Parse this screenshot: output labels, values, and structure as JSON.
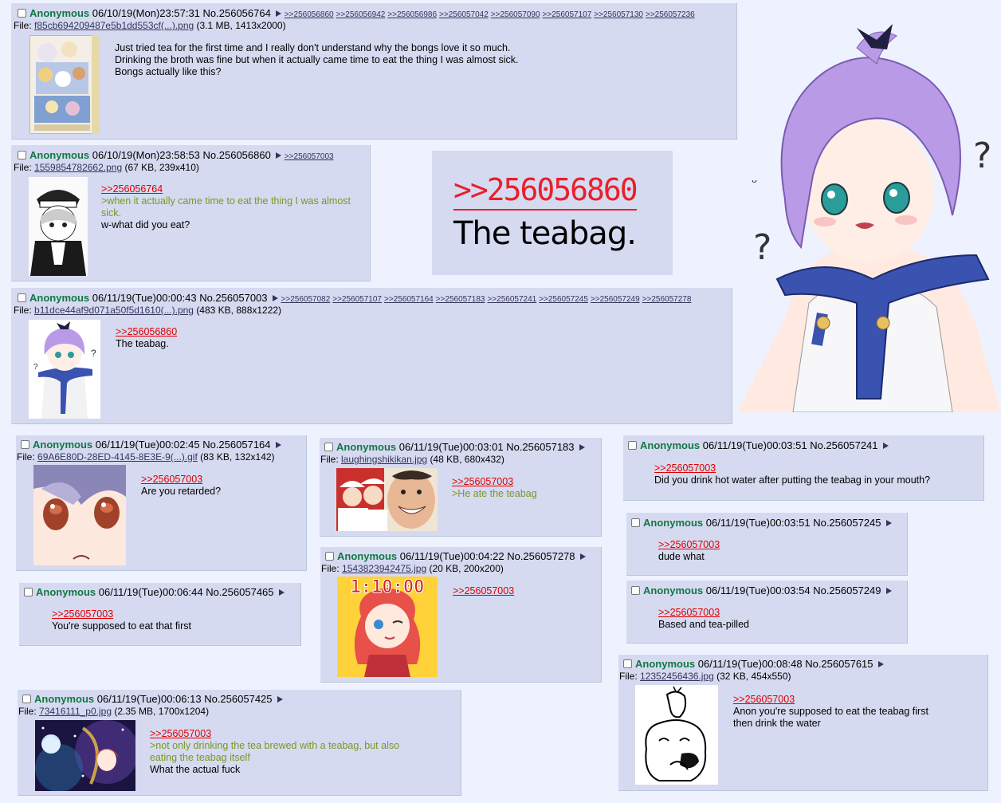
{
  "posts": {
    "p1": {
      "name": "Anonymous",
      "date": "06/10/19(Mon)23:57:31",
      "no": "No.256056764",
      "replies": [
        ">>256056860",
        ">>256056942",
        ">>256056986",
        ">>256057042",
        ">>256057090",
        ">>256057107",
        ">>256057130",
        ">>256057236"
      ],
      "file_label": "File:",
      "file_link": "f85cb694209487e5b1dd553cf(...).png",
      "file_info": "(3.1 MB, 1413x2000)",
      "lines": [
        "Just tried tea for the first time and I really don't understand why the bongs love it so much.",
        "Drinking the broth was fine but when it actually came time to eat the thing I was almost sick.",
        "Bongs actually like this?"
      ]
    },
    "p2": {
      "name": "Anonymous",
      "date": "06/10/19(Mon)23:58:53",
      "no": "No.256056860",
      "replies": [
        ">>256057003"
      ],
      "file_label": "File:",
      "file_link": "1559854782662.png",
      "file_info": "(67 KB, 239x410)",
      "quote": ">>256056764",
      "green": ">when it actually came time to eat the thing I was almost sick.",
      "text": "w-what did you eat?"
    },
    "p3": {
      "name": "Anonymous",
      "date": "06/11/19(Tue)00:00:43",
      "no": "No.256057003",
      "replies": [
        ">>256057082",
        ">>256057107",
        ">>256057164",
        ">>256057183",
        ">>256057241",
        ">>256057245",
        ">>256057249",
        ">>256057278"
      ],
      "file_label": "File:",
      "file_link": "b11dce44af9d071a50f5d1610(...).png",
      "file_info": "(483 KB, 888x1222)",
      "quote": ">>256056860",
      "text": "The teabag."
    },
    "p4": {
      "name": "Anonymous",
      "date": "06/11/19(Tue)00:02:45",
      "no": "No.256057164",
      "file_label": "File:",
      "file_link": "69A6E80D-28ED-4145-8E3E-9(...).gif",
      "file_info": "(83 KB, 132x142)",
      "quote": ">>256057003",
      "text": "Are you retarded?"
    },
    "p5": {
      "name": "Anonymous",
      "date": "06/11/19(Tue)00:03:01",
      "no": "No.256057183",
      "file_label": "File:",
      "file_link": "laughingshikikan.jpg",
      "file_info": "(48 KB, 680x432)",
      "quote": ">>256057003",
      "green": ">He ate the teabag"
    },
    "p6": {
      "name": "Anonymous",
      "date": "06/11/19(Tue)00:03:51",
      "no": "No.256057241",
      "quote": ">>256057003",
      "text": "Did you drink hot water after putting the teabag in your mouth?"
    },
    "p7": {
      "name": "Anonymous",
      "date": "06/11/19(Tue)00:03:51",
      "no": "No.256057245",
      "quote": ">>256057003",
      "text": "dude what"
    },
    "p8": {
      "name": "Anonymous",
      "date": "06/11/19(Tue)00:04:22",
      "no": "No.256057278",
      "file_label": "File:",
      "file_link": "1543823942475.jpg",
      "file_info": "(20 KB, 200x200)",
      "thumb_text": "1:10:00",
      "quote": ">>256057003"
    },
    "p9": {
      "name": "Anonymous",
      "date": "06/11/19(Tue)00:03:54",
      "no": "No.256057249",
      "quote": ">>256057003",
      "text": "Based and tea-pilled"
    },
    "p10": {
      "name": "Anonymous",
      "date": "06/11/19(Tue)00:06:44",
      "no": "No.256057465",
      "quote": ">>256057003",
      "text": "You're supposed to eat that first"
    },
    "p11": {
      "name": "Anonymous",
      "date": "06/11/19(Tue)00:08:48",
      "no": "No.256057615",
      "file_label": "File:",
      "file_link": "12352456436.jpg",
      "file_info": "(32 KB, 454x550)",
      "quote": ">>256057003",
      "lines": [
        "Anon you're supposed to eat the teabag first",
        "then drink the water"
      ]
    },
    "p12": {
      "name": "Anonymous",
      "date": "06/11/19(Tue)00:06:13",
      "no": "No.256057425",
      "file_label": "File:",
      "file_link": "73416111_p0.jpg",
      "file_info": "(2.35 MB, 1700x1204)",
      "quote": ">>256057003",
      "green": ">not only drinking the tea brewed with a teabag, but also eating the teabag itself",
      "text": "What the actual fuck"
    }
  },
  "bigcard": {
    "quote": ">>256056860",
    "text": "The teabag."
  },
  "colors": {
    "post_bg": "#d6daf0",
    "name": "#117743",
    "quote": "#dd0000",
    "greentext": "#789922",
    "link": "#34345c"
  }
}
